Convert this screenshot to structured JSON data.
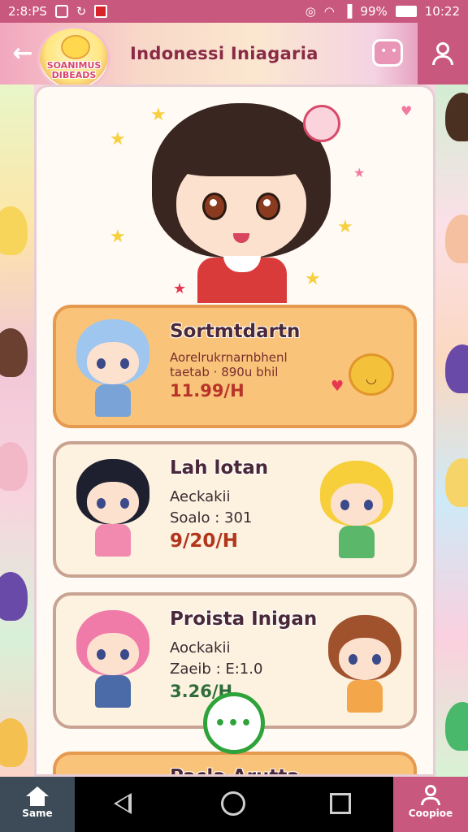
{
  "status_bar": {
    "left_text": "2:8:PS",
    "battery": "99%",
    "time": "10:22"
  },
  "header": {
    "logo_text": "SOANIMUS DIBEADS",
    "title": "Indonessi Iniagaria"
  },
  "cards": [
    {
      "title": "Sortmtdartn",
      "line1": "Aorelrukrnarnbhenl",
      "line2": "taetab  · 890u bhil",
      "price": "11.99/H"
    },
    {
      "title": "Lah lotan",
      "line1": "Aeckakii",
      "line2": "Soalo : 301",
      "price": "9/20/H"
    },
    {
      "title": "Proista Inigan",
      "line1": "Aockakii",
      "line2": "Zaeib : E:1.0",
      "price": "3.26/H"
    },
    {
      "title": "Pacla Arutta"
    }
  ],
  "fab": {
    "icon": "more-icon",
    "label": "•••"
  },
  "bottom_nav": {
    "home_label": "Same",
    "profile_label": "Coopioe"
  },
  "colors": {
    "accent_pink": "#c9587e",
    "card_orange": "#f9c37a",
    "fab_green": "#2ea33a"
  }
}
